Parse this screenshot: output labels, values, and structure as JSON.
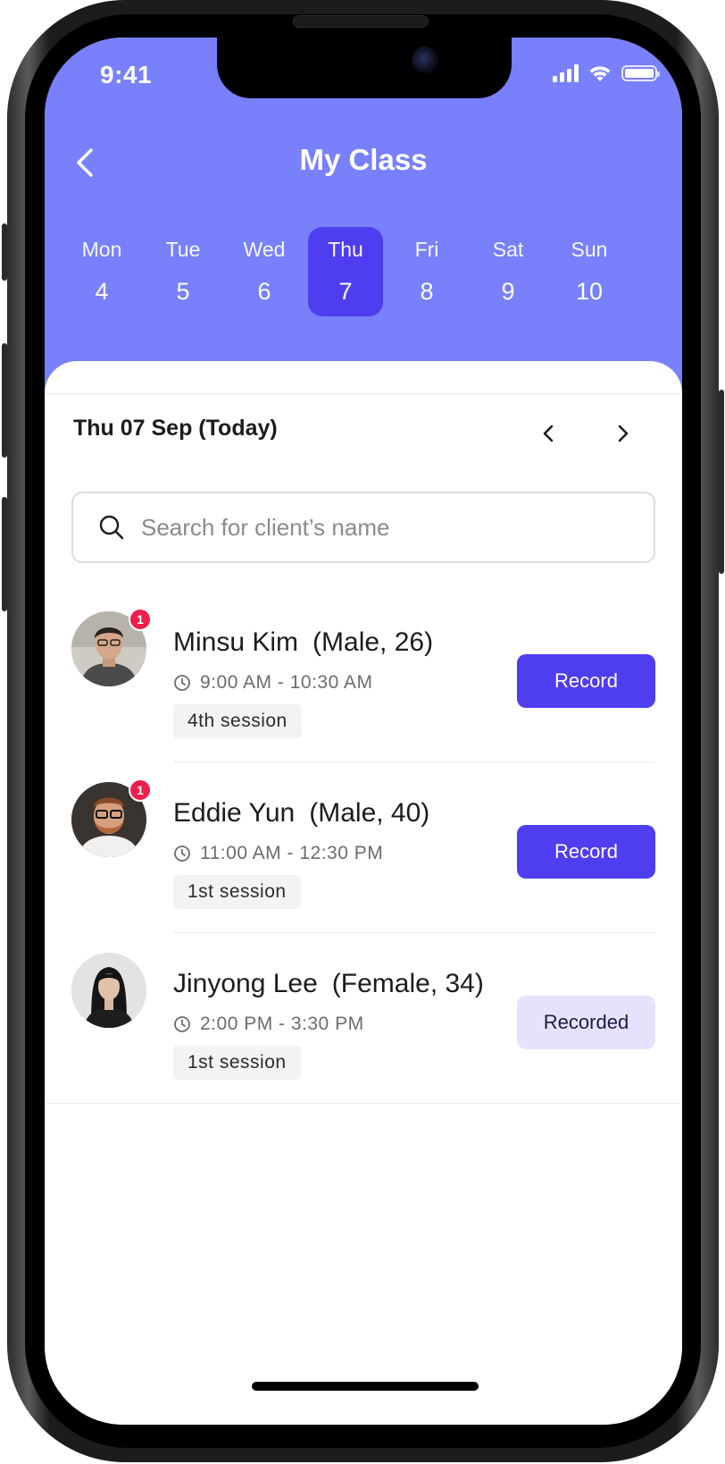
{
  "status_bar": {
    "time": "9:41"
  },
  "header": {
    "title": "My Class"
  },
  "week": [
    {
      "day": "Mon",
      "date": "4"
    },
    {
      "day": "Tue",
      "date": "5"
    },
    {
      "day": "Wed",
      "date": "6"
    },
    {
      "day": "Thu",
      "date": "7",
      "selected": true
    },
    {
      "day": "Fri",
      "date": "8"
    },
    {
      "day": "Sat",
      "date": "9"
    },
    {
      "day": "Sun",
      "date": "10"
    }
  ],
  "schedule": {
    "date_label": "Thu 07 Sep (Today)",
    "search_placeholder": "Search for client’s name"
  },
  "clients": [
    {
      "name": "Minsu Kim",
      "info": "(Male, 26)",
      "time": "9:00 AM - 10:30 AM",
      "session": "4th session",
      "badge": "1",
      "action": "Record",
      "recorded": false
    },
    {
      "name": "Eddie Yun",
      "info": "(Male, 40)",
      "time": "11:00 AM - 12:30 PM",
      "session": "1st session",
      "badge": "1",
      "action": "Record",
      "recorded": false
    },
    {
      "name": "Jinyong Lee",
      "info": "(Female, 34)",
      "time": "2:00 PM - 3:30 PM",
      "session": "1st session",
      "badge": "",
      "action": "Recorded",
      "recorded": true
    }
  ],
  "colors": {
    "header_bg": "#7880fb",
    "accent": "#4f3df0",
    "recorded_bg": "#e4e2fd",
    "badge": "#ef1f4b"
  }
}
